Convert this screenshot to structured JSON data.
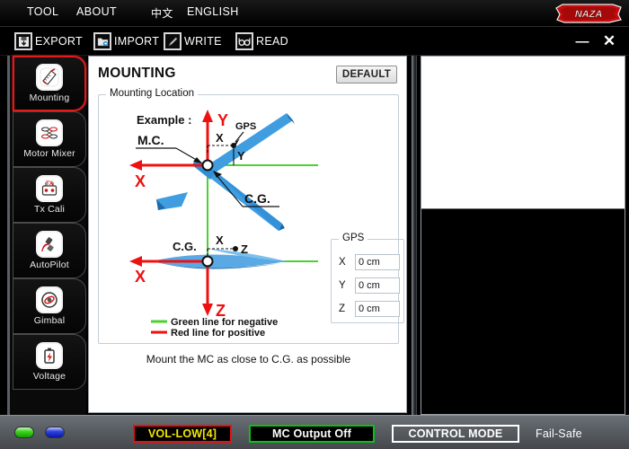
{
  "menubar": {
    "items": [
      {
        "label": "TOOL",
        "name": "menu-tool"
      },
      {
        "label": "ABOUT",
        "name": "menu-about"
      },
      {
        "label": "中文",
        "name": "menu-chinese"
      },
      {
        "label": "ENGLISH",
        "name": "menu-english"
      }
    ],
    "logo_text": "NAZA"
  },
  "toolbar": {
    "export_label": "EXPORT",
    "import_label": "IMPORT",
    "write_label": "WRITE",
    "read_label": "READ",
    "minimize_glyph": "—",
    "close_glyph": "✕"
  },
  "sidebar": {
    "items": [
      {
        "label": "Mounting",
        "icon": "mounting-icon",
        "active": true
      },
      {
        "label": "Motor Mixer",
        "icon": "motor-mixer-icon",
        "active": false
      },
      {
        "label": "Tx Cali",
        "icon": "tx-cali-icon",
        "active": false
      },
      {
        "label": "AutoPilot",
        "icon": "autopilot-icon",
        "active": false
      },
      {
        "label": "Gimbal",
        "icon": "gimbal-icon",
        "active": false
      },
      {
        "label": "Voltage",
        "icon": "voltage-icon",
        "active": false
      }
    ]
  },
  "main": {
    "title": "MOUNTING",
    "default_button": "DEFAULT",
    "mounting_location_legend": "Mounting Location",
    "diagram": {
      "example_label": "Example :",
      "mc_label": "M.C.",
      "gps_label": "GPS",
      "cg_label_top": "C.G.",
      "cg_label_bottom": "C.G.",
      "axis_x_top": "X",
      "axis_y_top": "Y",
      "axis_x_bottom": "X",
      "axis_z_bottom": "Z",
      "offset_x_top": "X",
      "offset_y_top": "Y",
      "offset_x_bottom": "X",
      "offset_z_bottom": "Z",
      "legend_green": "Green line for negative",
      "legend_red": "Red line for positive",
      "color_green": "#4bd132",
      "color_red": "#ee1111",
      "color_body": "#2f8ed6"
    },
    "gps": {
      "legend": "GPS",
      "fields": [
        {
          "axis": "X",
          "value": "0 cm"
        },
        {
          "axis": "Y",
          "value": "0 cm"
        },
        {
          "axis": "Z",
          "value": "0 cm"
        }
      ]
    },
    "hint": "Mount the MC as close to C.G. as possible"
  },
  "statusbar": {
    "led_green": "green-led",
    "led_blue": "blue-led",
    "voltage": "VOL-LOW[4]",
    "mc_output": "MC Output Off",
    "control_mode": "CONTROL MODE",
    "failsafe": "Fail-Safe",
    "colors": {
      "voltage_text": "#f3e600",
      "voltage_border": "#e81010",
      "mc_border": "#0ac015"
    }
  }
}
